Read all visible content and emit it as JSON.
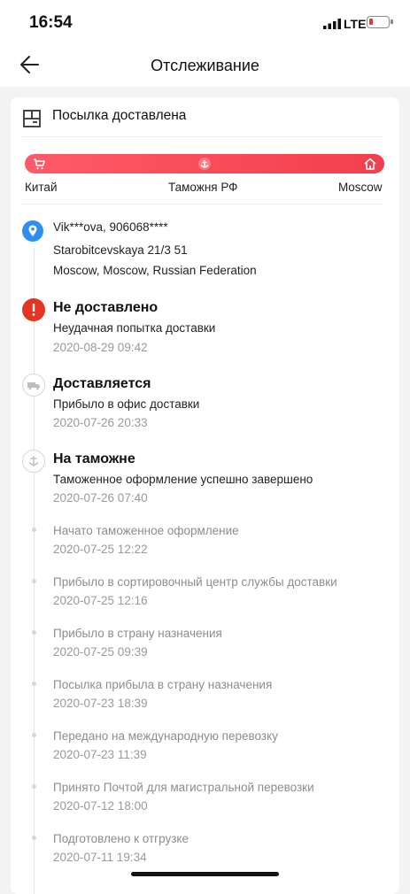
{
  "status_bar": {
    "time": "16:54",
    "network": "LTE"
  },
  "header": {
    "title": "Отслеживание"
  },
  "parcel": {
    "status": "Посылка доставлена",
    "stages": [
      "Китай",
      "Таможня РФ",
      "Moscow"
    ]
  },
  "address": {
    "name": "Vik***ova, 906068****",
    "street": "Starobitcevskaya 21/3 51",
    "city": "Moscow, Moscow, Russian Federation"
  },
  "events": [
    {
      "title": "Не доставлено",
      "desc": "Неудачная попытка доставки",
      "date": "2020-08-29 09:42",
      "icon": "alert-icon"
    },
    {
      "title": "Доставляется",
      "desc": "Прибыло в офис доставки",
      "date": "2020-07-26 20:33",
      "icon": "truck-icon"
    },
    {
      "title": "На таможне",
      "desc": "Таможенное оформление успешно завершено",
      "date": "2020-07-26 07:40",
      "icon": "customs-icon"
    }
  ],
  "sub_events": [
    {
      "desc": "Начато таможенное оформление",
      "date": "2020-07-25 12:22"
    },
    {
      "desc": "Прибыло в сортировочный центр службы доставки",
      "date": "2020-07-25 12:16"
    },
    {
      "desc": "Прибыло в страну назначения",
      "date": "2020-07-25 09:39"
    },
    {
      "desc": "Посылка прибыла в страну назначения",
      "date": "2020-07-23 18:39"
    },
    {
      "desc": "Передано на международную перевозку",
      "date": "2020-07-23 11:39"
    },
    {
      "desc": "Принято Почтой для магистральной перевозки",
      "date": "2020-07-12 18:00"
    },
    {
      "desc": "Подготовлено к отгрузке",
      "date": "2020-07-11 19:34"
    }
  ],
  "colors": {
    "accent": "#f23f4d",
    "alert": "#e53424",
    "location": "#2d8ff0"
  }
}
